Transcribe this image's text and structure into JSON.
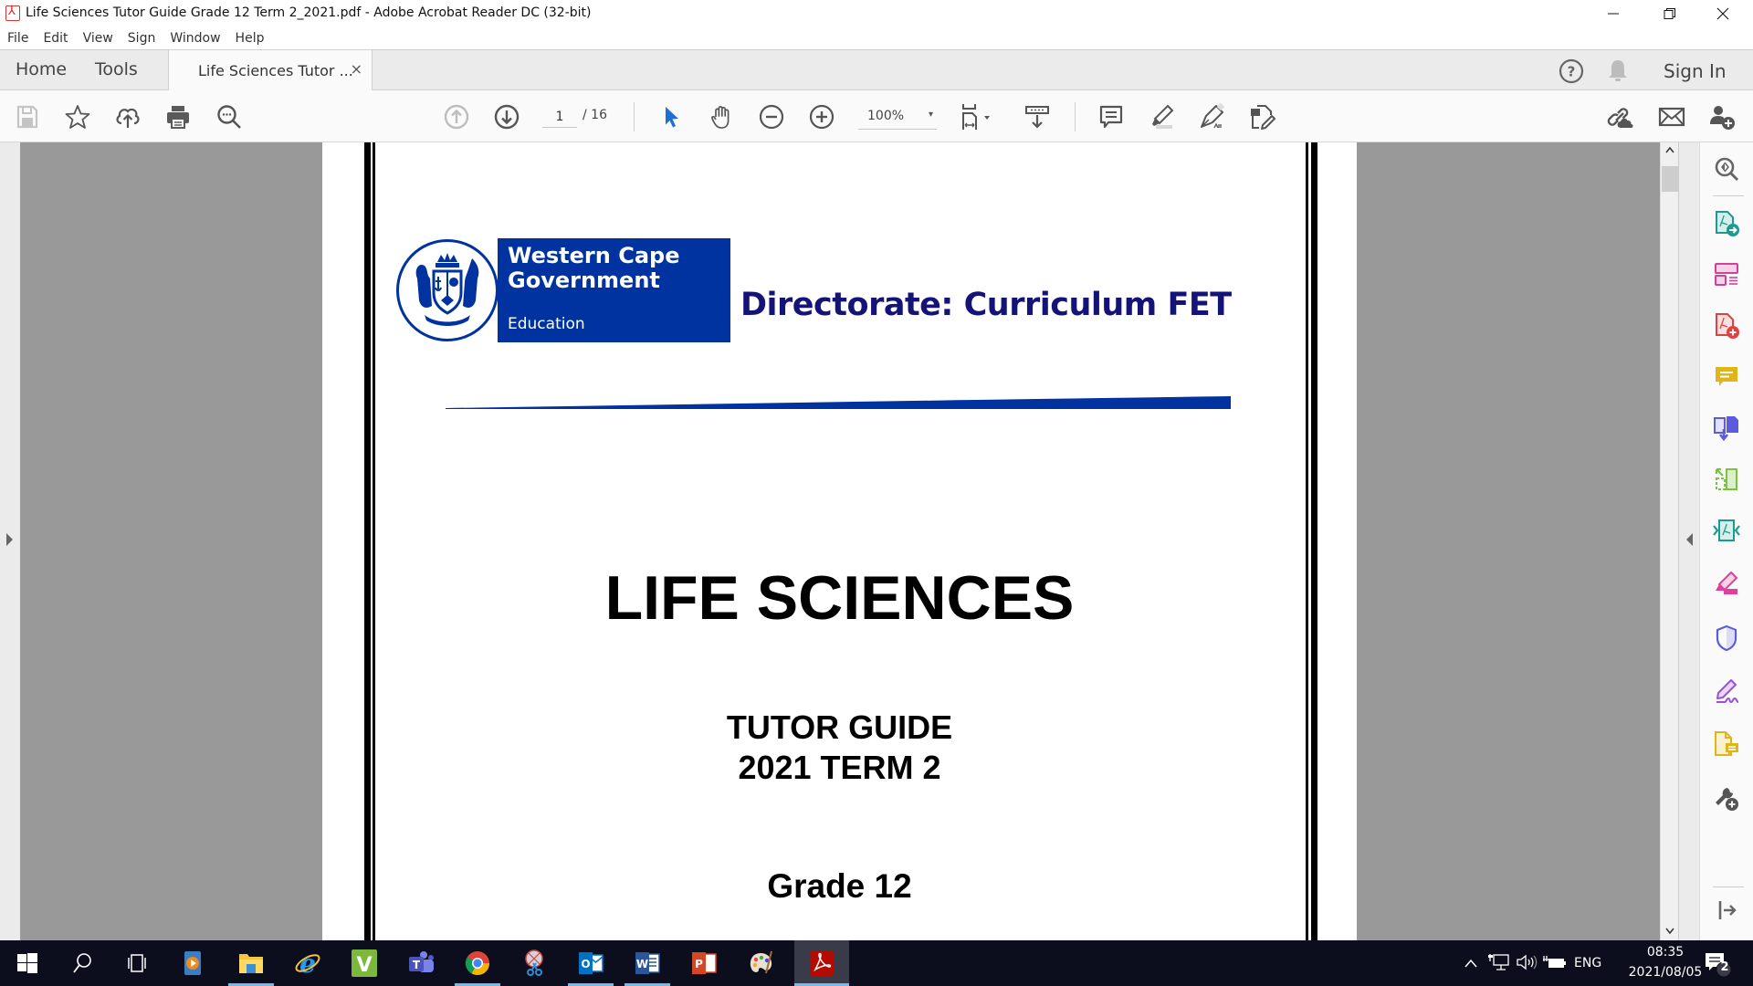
{
  "window": {
    "title": "Life Sciences Tutor Guide Grade 12 Term 2_2021.pdf - Adobe Acrobat Reader DC (32-bit)",
    "controls": {
      "minimize": "—",
      "restore": "❐",
      "close": "✕"
    }
  },
  "menu": [
    "File",
    "Edit",
    "View",
    "Sign",
    "Window",
    "Help"
  ],
  "tabs": {
    "home": "Home",
    "tools": "Tools",
    "document": "Life Sciences Tutor ...",
    "document_close": "×"
  },
  "tabbar_right": {
    "help_icon": "help-icon",
    "notifications_icon": "bell-icon",
    "sign_in": "Sign In"
  },
  "toolbar": {
    "left_icons": [
      "save-icon",
      "bookmark-star-icon",
      "upload-cloud-icon",
      "print-icon",
      "find-text-icon"
    ],
    "page_current": "1",
    "page_total": "/  16",
    "zoom_value": "100%",
    "zoom_caret": "▾",
    "right_icons": [
      "share-link-icon",
      "email-icon",
      "add-user-icon"
    ]
  },
  "tools_panel": {
    "icons": [
      {
        "name": "enhance-scan-zoom-icon",
        "color": "#666666"
      },
      {
        "name": "export-pdf-icon",
        "color": "#1a9b8f"
      },
      {
        "name": "organize-pages-icon",
        "color": "#d43f9a"
      },
      {
        "name": "create-pdf-icon",
        "color": "#e04040"
      },
      {
        "name": "comment-icon",
        "color": "#e0b51a"
      },
      {
        "name": "combine-files-icon",
        "color": "#5b5bdc"
      },
      {
        "name": "organize-crop-icon",
        "color": "#7cc242"
      },
      {
        "name": "compress-pdf-icon",
        "color": "#1a9b8f"
      },
      {
        "name": "fill-sign-highlight-icon",
        "color": "#e0409a"
      },
      {
        "name": "protect-shield-icon",
        "color": "#5b5bdc"
      },
      {
        "name": "request-signature-icon",
        "color": "#9b50d8"
      },
      {
        "name": "send-for-comments-icon",
        "color": "#e0b51a"
      },
      {
        "name": "more-tools-icon",
        "color": "#555555"
      },
      {
        "name": "collapse-panel-icon",
        "color": "#555555"
      }
    ]
  },
  "document": {
    "logo": {
      "line1": "Western Cape",
      "line2": "Government",
      "line3": "Education"
    },
    "directorate": "Directorate: Curriculum FET",
    "title": "LIFE SCIENCES",
    "subtitle1": "TUTOR GUIDE",
    "subtitle2": "2021 TERM 2",
    "grade": "Grade 12",
    "colors": {
      "brand_blue": "#0033a0",
      "directorate_text": "#141478"
    }
  },
  "taskbar": {
    "apps": [
      {
        "name": "start-button",
        "running": false
      },
      {
        "name": "search-button",
        "running": false
      },
      {
        "name": "task-view-button",
        "running": false
      },
      {
        "name": "media-player-app",
        "running": false
      },
      {
        "name": "file-explorer-app",
        "running": true
      },
      {
        "name": "internet-explorer-app",
        "running": false
      },
      {
        "name": "v-app",
        "running": false
      },
      {
        "name": "teams-app",
        "running": false
      },
      {
        "name": "chrome-app",
        "running": true
      },
      {
        "name": "snipping-tool-app",
        "running": false
      },
      {
        "name": "outlook-app",
        "running": true
      },
      {
        "name": "word-app",
        "running": true
      },
      {
        "name": "powerpoint-app",
        "running": false
      },
      {
        "name": "paint-app",
        "running": false
      },
      {
        "name": "acrobat-app",
        "running": true,
        "active": true
      }
    ],
    "tray": {
      "language": "ENG",
      "time": "08:35",
      "date": "2021/08/05",
      "notifications_count": "2"
    }
  }
}
